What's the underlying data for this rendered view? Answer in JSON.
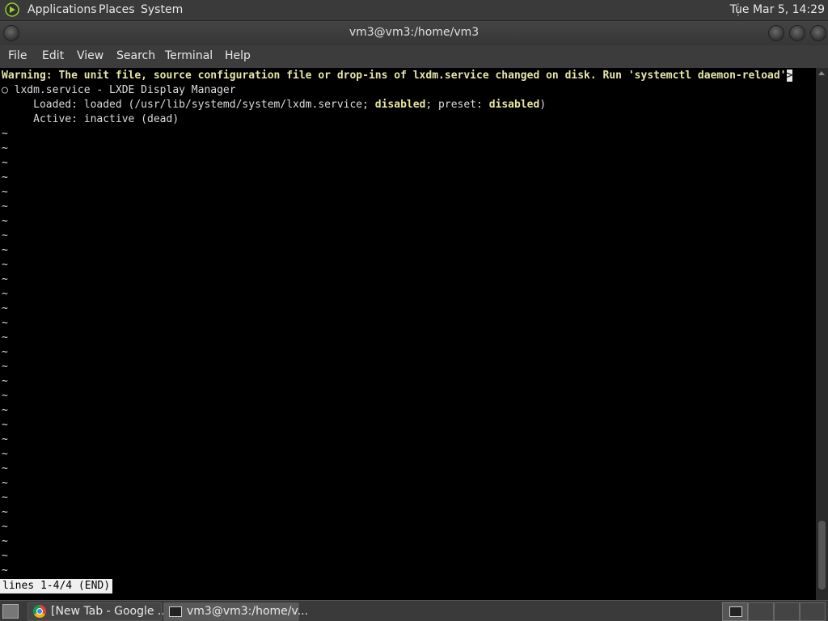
{
  "top_panel": {
    "menus": [
      "Applications",
      "Places",
      "System"
    ],
    "clock": "Tue Mar  5, 14:29"
  },
  "window": {
    "title": "vm3@vm3:/home/vm3"
  },
  "menubar": [
    "File",
    "Edit",
    "View",
    "Search",
    "Terminal",
    "Help"
  ],
  "terminal": {
    "warning": "Warning: The unit file, source configuration file or drop-ins of lxdm.service changed on disk. Run 'systemctl daemon-reload'",
    "truncation_marker": ">",
    "service_line": "○ lxdm.service - LXDE Display Manager",
    "loaded_prefix": "     Loaded: loaded (/usr/lib/systemd/system/lxdm.service; ",
    "loaded_state": "disabled",
    "loaded_mid": "; preset: ",
    "preset_state": "disabled",
    "loaded_suffix": ")",
    "active_line": "     Active: inactive (dead)",
    "filler": "~",
    "status": "lines 1-4/4 (END)"
  },
  "taskbar": {
    "tasks": [
      "[New Tab - Google ...",
      "vm3@vm3:/home/v..."
    ]
  },
  "icons": {
    "apps": "applications-icon",
    "chrome": "chrome-icon",
    "terminal": "terminal-icon",
    "desktop": "show-desktop-icon"
  }
}
